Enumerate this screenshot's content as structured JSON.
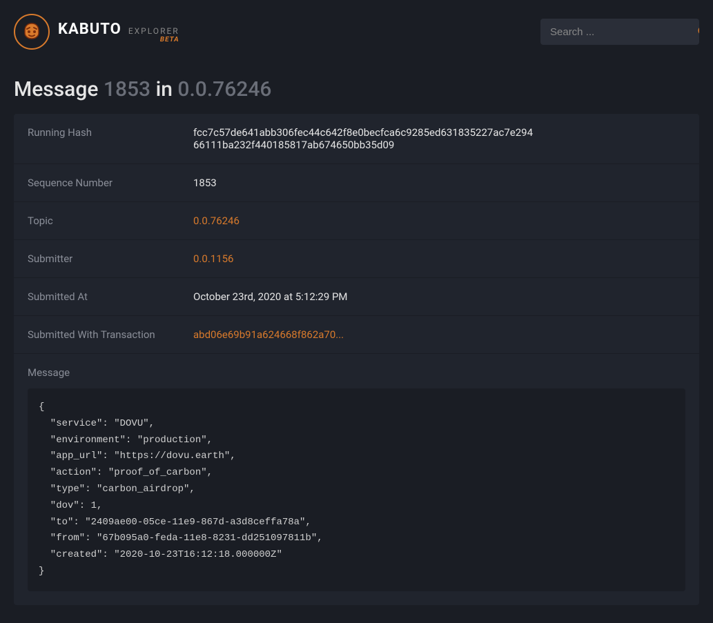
{
  "brand": {
    "name": "KABUTO",
    "explorer": "EXPLORER",
    "beta": "BETA"
  },
  "search": {
    "placeholder": "Search ..."
  },
  "title": {
    "prefix": "Message",
    "message_id": "1853",
    "in": "in",
    "topic_id": "0.0.76246"
  },
  "details": {
    "running_hash": {
      "label": "Running Hash",
      "value": "fcc7c57de641abb306fec44c642f8e0becfca6c9285ed631835227ac7e29466111ba232f440185817ab674650bb35d09"
    },
    "sequence_number": {
      "label": "Sequence Number",
      "value": "1853"
    },
    "topic": {
      "label": "Topic",
      "value": "0.0.76246"
    },
    "submitter": {
      "label": "Submitter",
      "value": "0.0.1156"
    },
    "submitted_at": {
      "label": "Submitted At",
      "value": "October 23rd, 2020 at 5:12:29 PM"
    },
    "submitted_with_transaction": {
      "label": "Submitted With Transaction",
      "value": "abd06e69b91a624668f862a70..."
    }
  },
  "message": {
    "label": "Message",
    "content": "{\n  \"service\": \"DOVU\",\n  \"environment\": \"production\",\n  \"app_url\": \"https://dovu.earth\",\n  \"action\": \"proof_of_carbon\",\n  \"type\": \"carbon_airdrop\",\n  \"dov\": 1,\n  \"to\": \"2409ae00-05ce-11e9-867d-a3d8ceffa78a\",\n  \"from\": \"67b095a0-feda-11e8-8231-dd251097811b\",\n  \"created\": \"2020-10-23T16:12:18.000000Z\"\n}"
  }
}
